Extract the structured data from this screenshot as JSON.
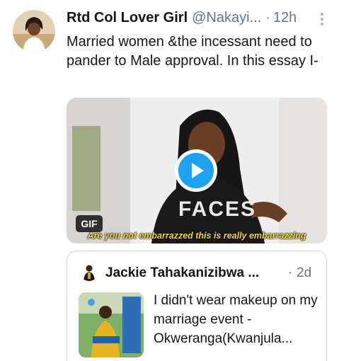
{
  "tweet": {
    "display_name": "Rtd Col Lover Girl",
    "handle": "@Nakayi...",
    "separator": "·",
    "time": "12h",
    "text": "Married women &the incessant need to pander to Male approval. In this essay I-",
    "media": {
      "type_badge": "GIF",
      "caption": "Are you not embarrazzed this is really embarrazzing",
      "overlay_text": "FACES"
    }
  },
  "quoted_tweet": {
    "display_name": "Jackie Tahakanizibwa ...",
    "separator": "·",
    "time": "2d",
    "text": "I didn't wear makeup on my marriage event - Okweranga(Kwanjula..."
  },
  "icons": {
    "more": "more-vertical-icon",
    "play": "play-icon"
  },
  "colors": {
    "accent": "#1da1f2",
    "secondary_text": "#657786",
    "caption": "#f7d43a"
  }
}
